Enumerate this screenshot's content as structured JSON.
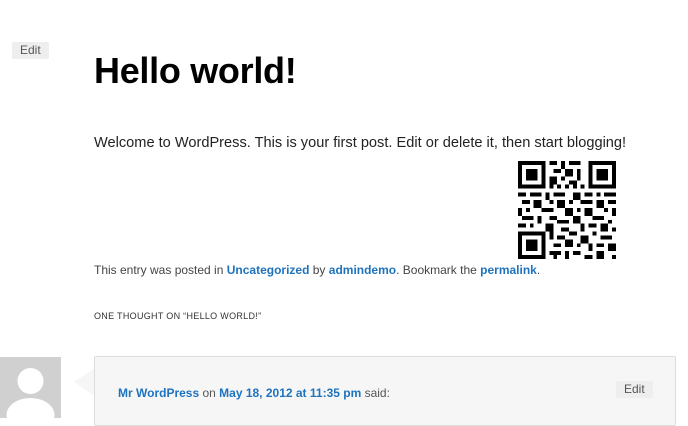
{
  "post": {
    "edit_label": "Edit",
    "title": "Hello world!",
    "content": "Welcome to WordPress. This is your first post. Edit or delete it, then start blogging!",
    "meta": {
      "prefix": "This entry was posted in ",
      "category": "Uncategorized",
      "by": " by ",
      "author": "admindemo",
      "bookmark": ". Bookmark the ",
      "permalink": "permalink",
      "suffix": "."
    }
  },
  "comments": {
    "title": "One thought on “Hello world!”",
    "items": [
      {
        "author": "Mr WordPress",
        "on": " on ",
        "date": "May 18, 2012 at 11:35 pm",
        "said": " said:",
        "edit_label": "Edit"
      }
    ]
  },
  "colors": {
    "link": "#1e73be",
    "edit_bg": "#eeeeee",
    "comment_bg": "#f6f6f6"
  },
  "icons": {
    "qr": "qr-code-icon",
    "avatar": "default-avatar-icon"
  }
}
